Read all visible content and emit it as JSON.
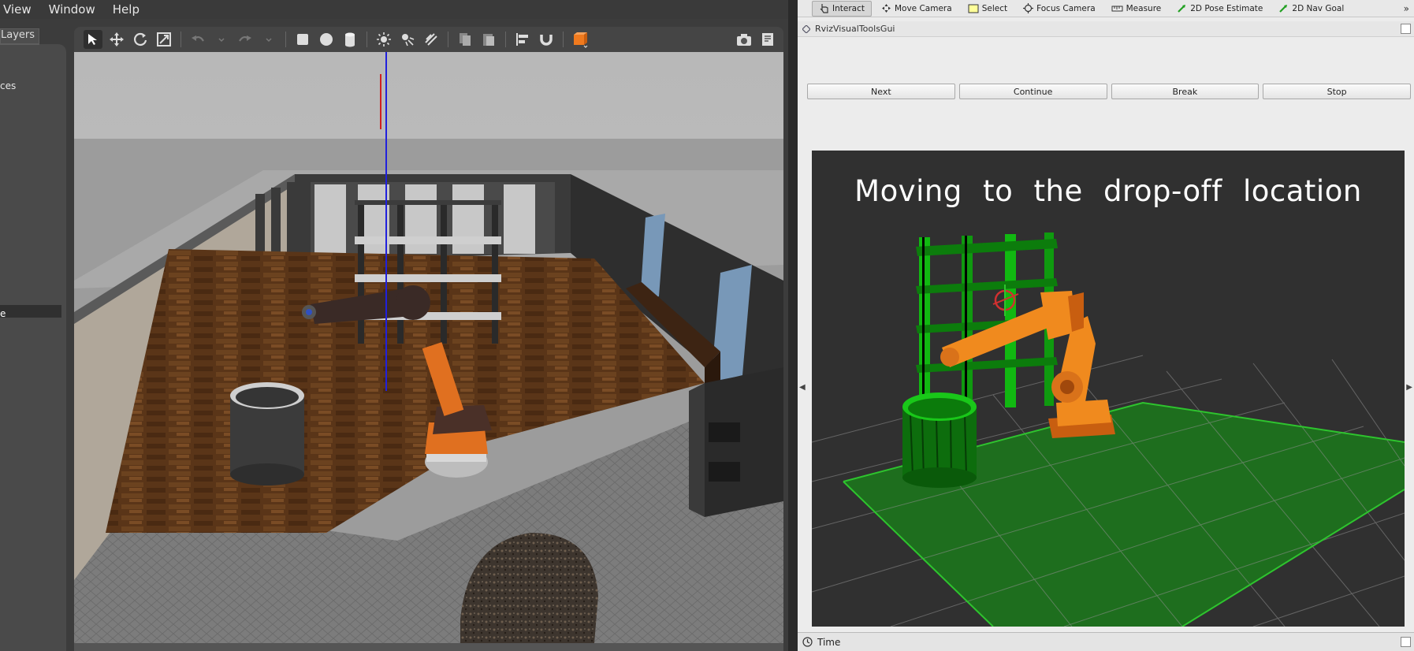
{
  "gazebo": {
    "menus": [
      "View",
      "Window",
      "Help"
    ],
    "layers_tab": "Layers",
    "left_list_fragment": "ces",
    "left_selected_fragment": "e"
  },
  "rviz": {
    "tools": [
      {
        "label": "Interact",
        "icon": "interact-icon"
      },
      {
        "label": "Move Camera",
        "icon": "move-camera-icon"
      },
      {
        "label": "Select",
        "icon": "select-icon"
      },
      {
        "label": "Focus Camera",
        "icon": "focus-camera-icon"
      },
      {
        "label": "Measure",
        "icon": "measure-icon"
      },
      {
        "label": "2D Pose Estimate",
        "icon": "pose-estimate-icon"
      },
      {
        "label": "2D Nav Goal",
        "icon": "nav-goal-icon"
      }
    ],
    "panel_title": "RvizVisualToolsGui",
    "buttons": {
      "next": "Next",
      "continue": "Continue",
      "break": "Break",
      "stop": "Stop"
    },
    "overlay_message": "Moving to the drop-off location",
    "time_label": "Time",
    "colors": {
      "grid": "#1fa51f",
      "robot": "#f08a1e",
      "background": "#303030"
    }
  }
}
